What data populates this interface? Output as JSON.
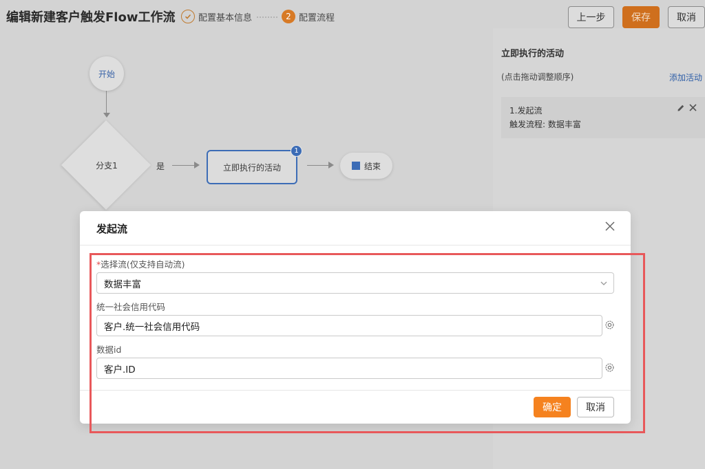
{
  "header": {
    "title": "编辑新建客户触发Flow工作流",
    "steps": [
      {
        "number": "",
        "label": "配置基本信息",
        "state": "done"
      },
      {
        "number": "2",
        "label": "配置流程",
        "state": "active"
      }
    ],
    "buttons": {
      "prev": "上一步",
      "save": "保存",
      "cancel": "取消"
    }
  },
  "canvas": {
    "start_node": "开始",
    "branch_node": "分支1",
    "branch_yes": "是",
    "activity_node": "立即执行的活动",
    "activity_badge": "1",
    "end_node": "结束"
  },
  "side_panel": {
    "title": "立即执行的活动",
    "hint": "(点击拖动调整顺序)",
    "add_link": "添加活动",
    "items": [
      {
        "name": "1.发起流",
        "detail": "触发流程: 数据丰富"
      }
    ]
  },
  "modal": {
    "title": "发起流",
    "required_mark": "*",
    "select_label": "选择流(仅支持自动流)",
    "select_value": "数据丰富",
    "field1_label": "统一社会信用代码",
    "field1_value": "客户.统一社会信用代码",
    "field2_label": "数据id",
    "field2_value": "客户.ID",
    "confirm": "确定",
    "cancel": "取消"
  },
  "colors": {
    "accent_orange": "#f5821f",
    "node_blue": "#3c6cb6",
    "highlight_red": "#e8585a"
  },
  "icons": {
    "step_done": "check-circle-icon",
    "close": "close-icon",
    "dropdown": "chevron-down-icon",
    "settings": "gear-icon",
    "edit": "pencil-icon"
  }
}
